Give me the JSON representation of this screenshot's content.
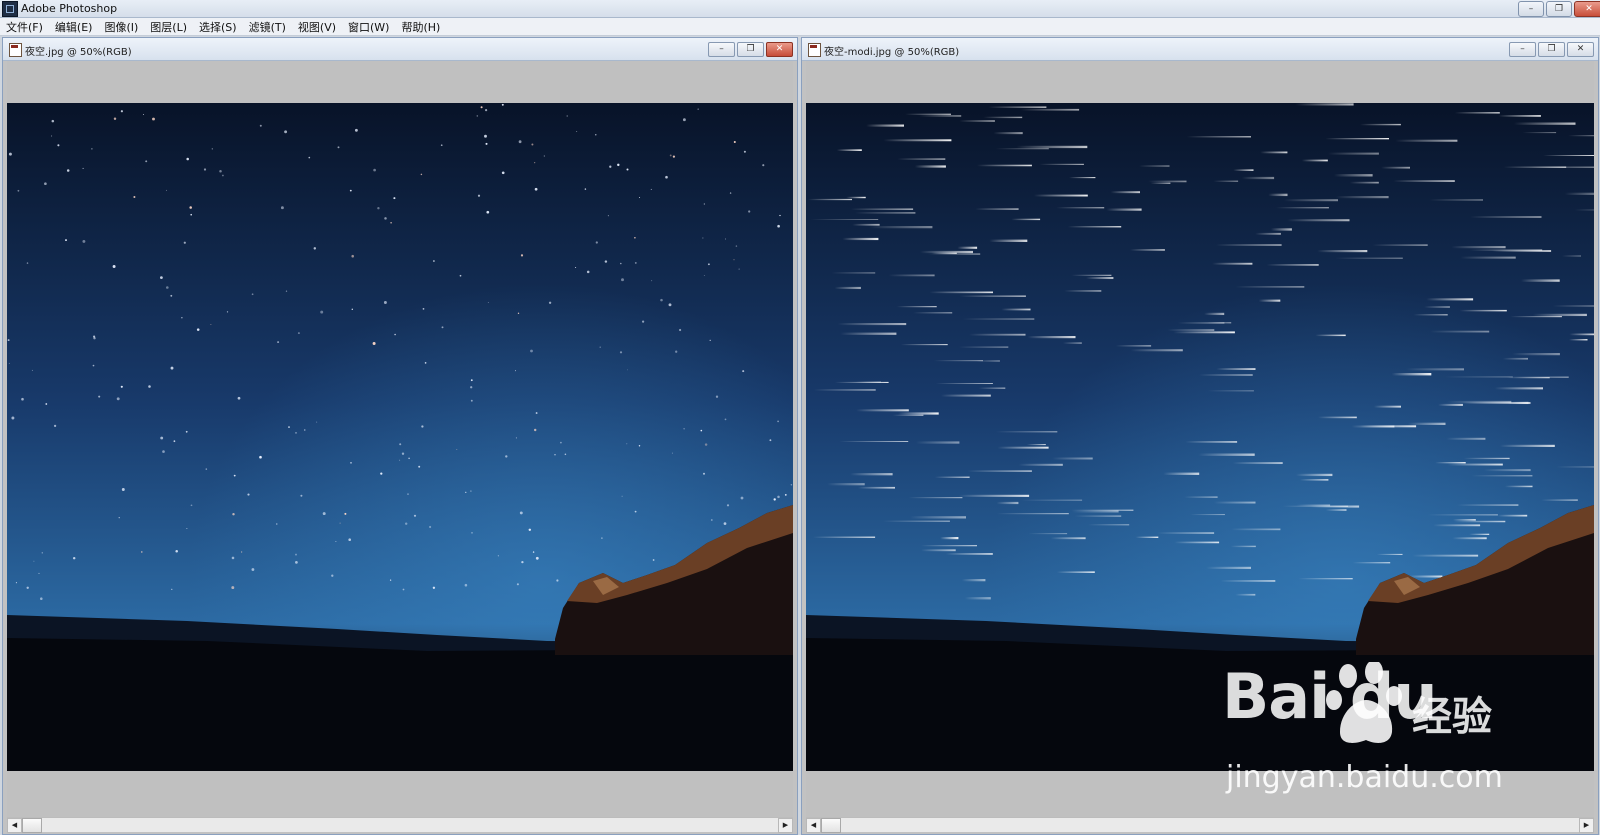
{
  "app": {
    "title": "Adobe Photoshop"
  },
  "window_controls": {
    "minimize": "–",
    "restore": "❐",
    "close": "✕"
  },
  "menu": [
    "文件(F)",
    "编辑(E)",
    "图像(I)",
    "图层(L)",
    "选择(S)",
    "滤镜(T)",
    "视图(V)",
    "窗口(W)",
    "帮助(H)"
  ],
  "documents": [
    {
      "title": "夜空.jpg @ 50%(RGB)",
      "image": "night-sky-original",
      "active": true
    },
    {
      "title": "夜空-modi.jpg @ 50%(RGB)",
      "image": "night-sky-star-trails",
      "active": false
    }
  ],
  "scroll": {
    "left": "◀",
    "right": "▶"
  },
  "watermark": {
    "logo": "Bai du",
    "cn": "经验",
    "url": "jingyan.baidu.com"
  },
  "colors": {
    "sky_top": "#0a1630",
    "sky_bottom": "#2e6fa8",
    "ground": "#05070d",
    "cliff": "#6a3f25",
    "close_red": "#c84f3a"
  }
}
